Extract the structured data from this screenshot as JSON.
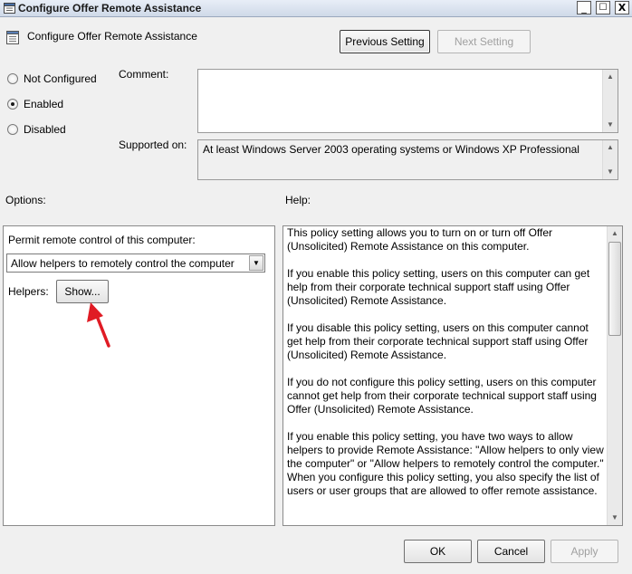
{
  "window": {
    "title": "Configure Offer Remote Assistance",
    "minimize_glyph": "_",
    "maximize_glyph": "☐",
    "close_glyph": "X"
  },
  "header": {
    "title": "Configure Offer Remote Assistance",
    "previous_label": "Previous Setting",
    "next_label": "Next Setting"
  },
  "state": {
    "options": [
      {
        "label": "Not Configured",
        "checked": false
      },
      {
        "label": "Enabled",
        "checked": true
      },
      {
        "label": "Disabled",
        "checked": false
      }
    ]
  },
  "comment": {
    "label": "Comment:",
    "value": ""
  },
  "supported": {
    "label": "Supported on:",
    "value": "At least Windows Server 2003 operating systems or Windows XP Professional"
  },
  "options_section": {
    "heading": "Options:",
    "permit_label": "Permit remote control of this computer:",
    "permit_selected": "Allow helpers to remotely control the computer",
    "helpers_label": "Helpers:",
    "show_button": "Show..."
  },
  "help_section": {
    "heading": "Help:",
    "paragraphs": [
      "This policy setting allows you to turn on or turn off Offer (Unsolicited) Remote Assistance on this computer.",
      "If you enable this policy setting, users on this computer can get help from their corporate technical support staff using Offer (Unsolicited) Remote Assistance.",
      "If you disable this policy setting, users on this computer cannot get help from their corporate technical support staff using Offer (Unsolicited) Remote Assistance.",
      "If you do not configure this policy setting, users on this computer cannot get help from their corporate technical support staff using Offer (Unsolicited) Remote Assistance.",
      "If you enable this policy setting, you have two ways to allow helpers to provide Remote Assistance: \"Allow helpers to only view the computer\" or \"Allow helpers to remotely control the computer.\" When you configure this policy setting, you also specify the list of users or user groups that are allowed to offer remote assistance."
    ]
  },
  "footer": {
    "ok": "OK",
    "cancel": "Cancel",
    "apply": "Apply"
  },
  "colors": {
    "annotation_arrow": "#e01b24"
  },
  "icons": {
    "title_icon": "policy-icon",
    "header_icon": "policy-icon",
    "annotation": "red-arrow-icon"
  }
}
